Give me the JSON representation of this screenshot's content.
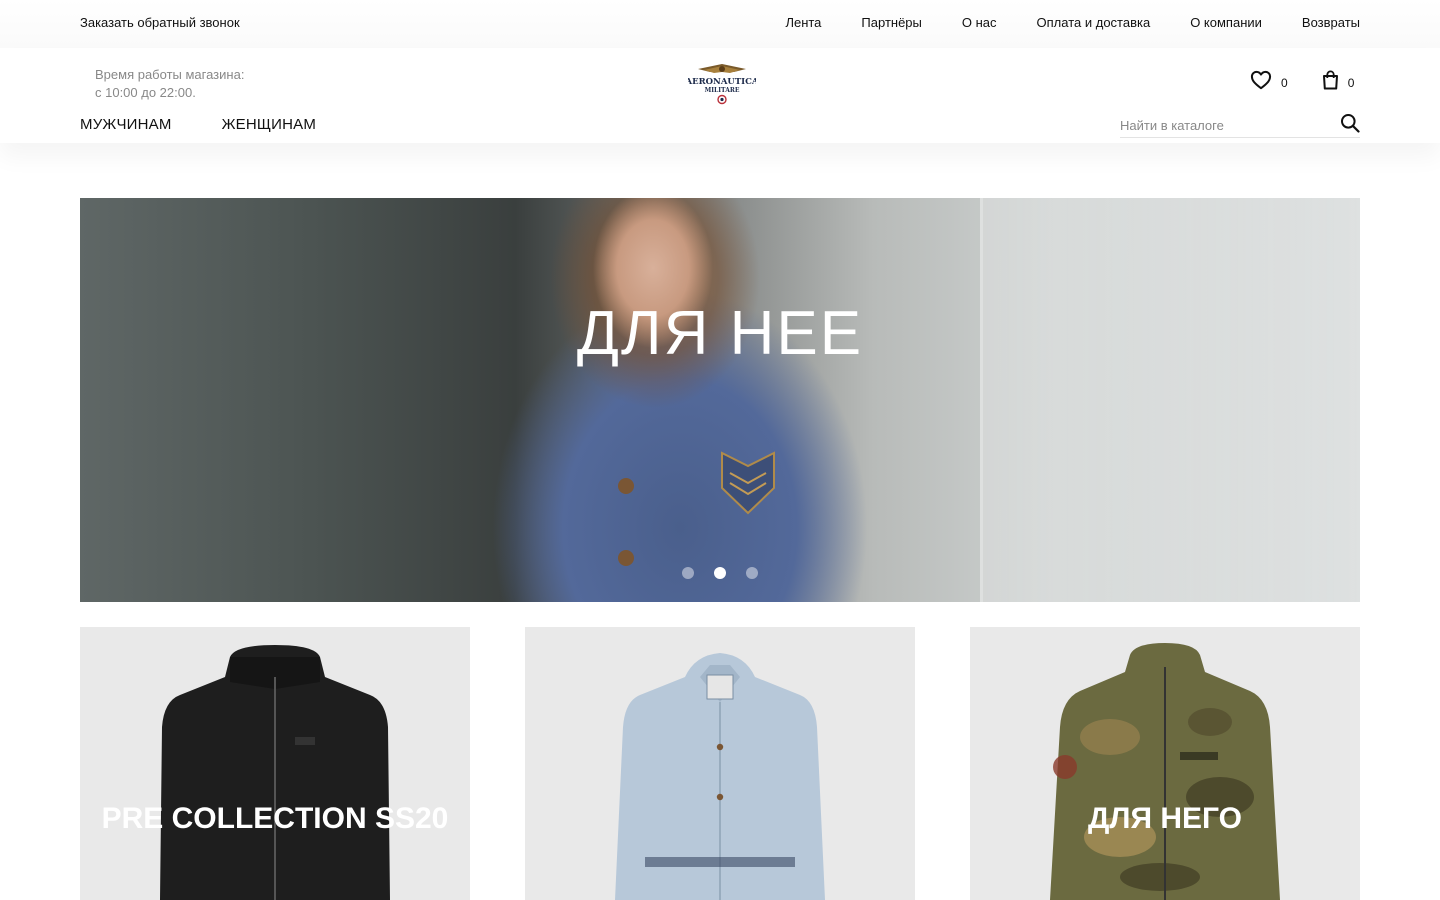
{
  "topbar": {
    "callback": "Заказать обратный звонок",
    "nav": [
      "Лента",
      "Партнёры",
      "О нас",
      "Оплата и доставка",
      "О компании",
      "Возвраты"
    ]
  },
  "header": {
    "hours_line1": "Время работы магазина:",
    "hours_line2": "с 10:00 до 22:00.",
    "logo_text": "AERONAUTICA",
    "logo_subtext": "MILITARE",
    "wishlist_count": "0",
    "cart_count": "0",
    "main_nav": [
      "МУЖЧИНАМ",
      "ЖЕНЩИНАМ"
    ],
    "search_placeholder": "Найти в каталоге"
  },
  "hero": {
    "title": "ДЛЯ НЕЕ",
    "slide_count": 3,
    "active_slide": 2
  },
  "cards": [
    {
      "title": "PRE COLLECTION SS20",
      "garment": "black jacket"
    },
    {
      "title": "",
      "garment": "light blue shirt dress"
    },
    {
      "title": "ДЛЯ НЕГО",
      "garment": "camouflage jacket"
    }
  ],
  "colors": {
    "text": "#111111",
    "muted": "#888888",
    "card_bg": "#e9e9e9",
    "logo_navy": "#1c2a4a",
    "logo_red": "#b9303a"
  }
}
